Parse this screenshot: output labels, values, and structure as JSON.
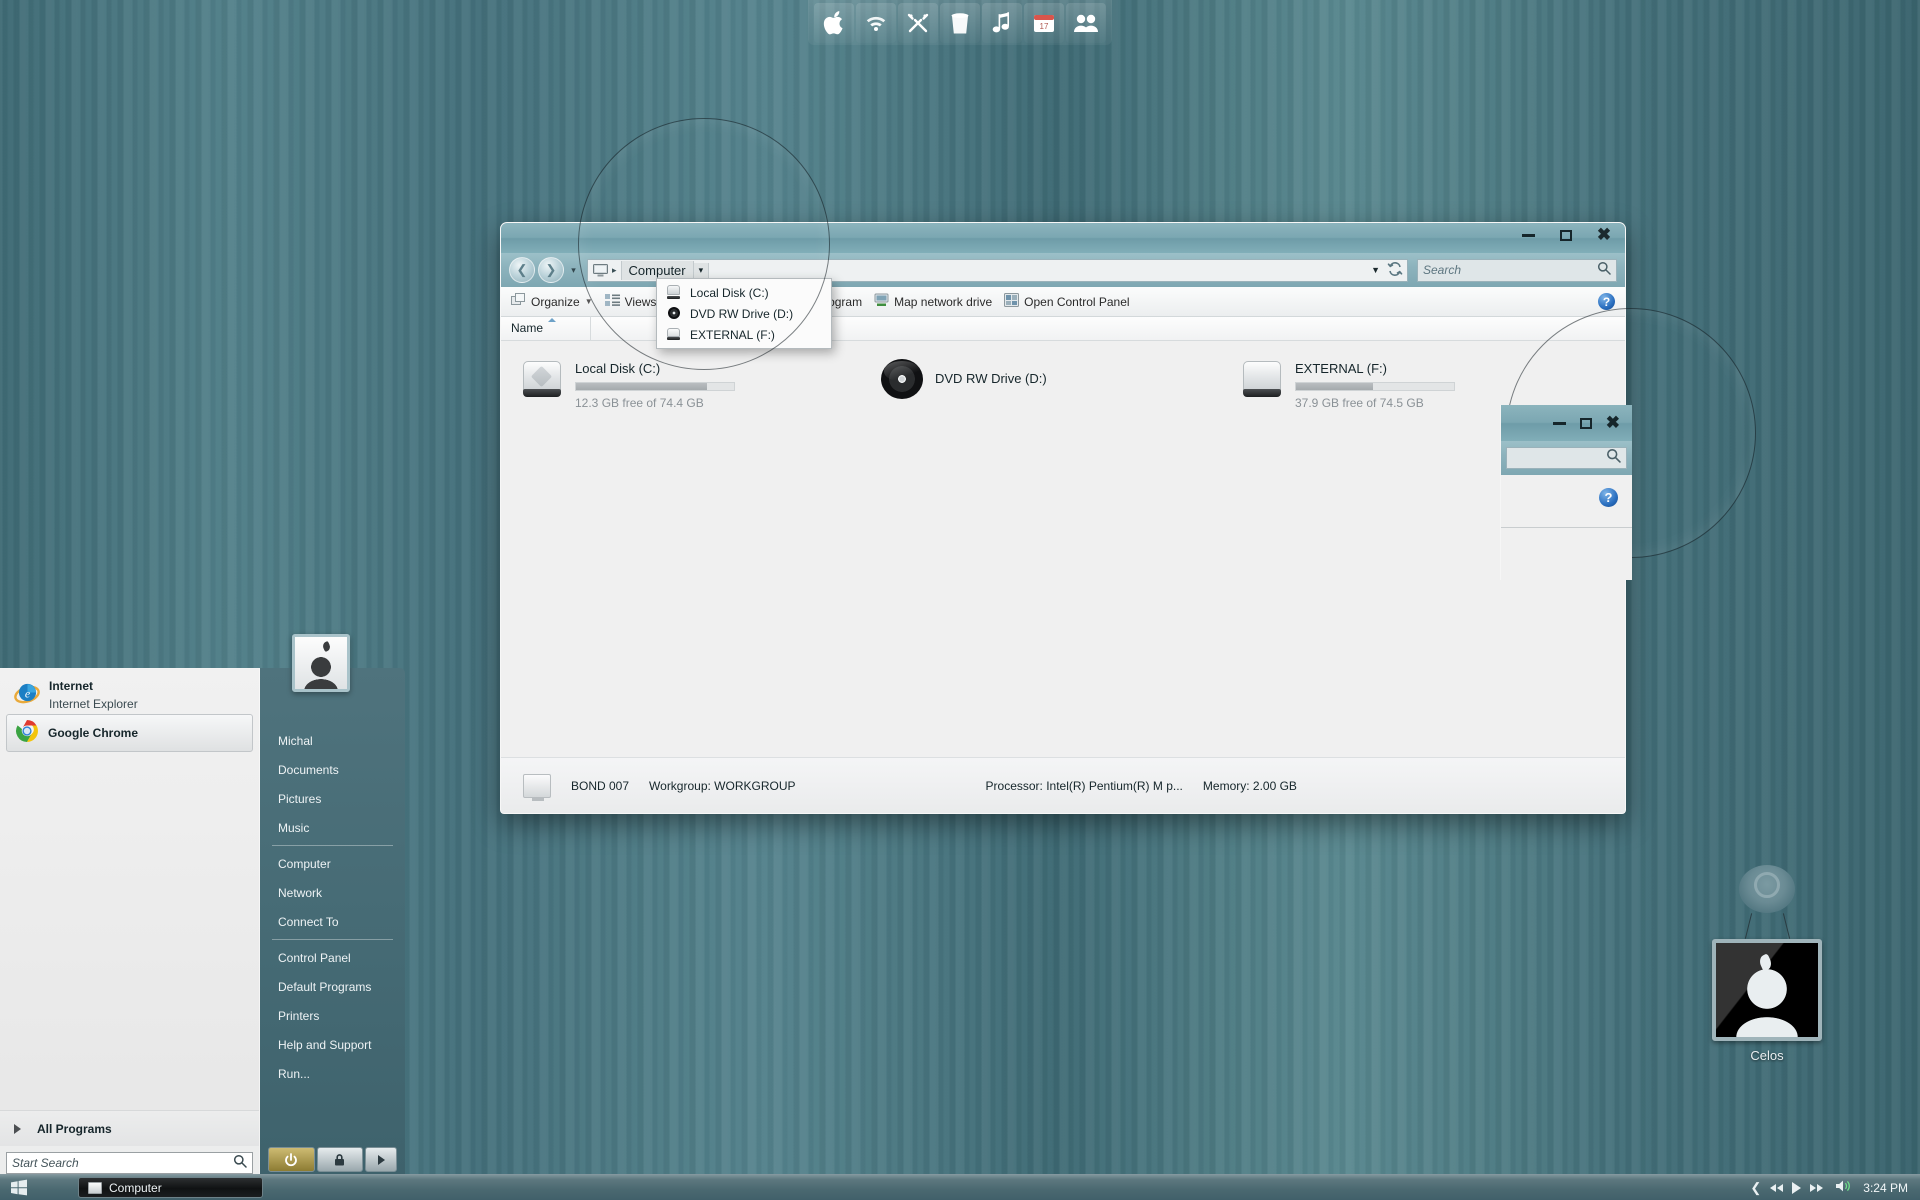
{
  "desktop": {
    "background_top": "#3f6b75",
    "background_bottom": "#5b8590"
  },
  "dock": {
    "items": [
      {
        "name": "apple-icon",
        "label": "Apple"
      },
      {
        "name": "wifi-icon",
        "label": "WiFi"
      },
      {
        "name": "tools-icon",
        "label": "Tools"
      },
      {
        "name": "trash-icon",
        "label": "Trash"
      },
      {
        "name": "music-icon",
        "label": "Music"
      },
      {
        "name": "calendar-icon",
        "label": "Calendar",
        "day": "17"
      },
      {
        "name": "users-icon",
        "label": "Users"
      }
    ]
  },
  "widget": {
    "label": "Celos"
  },
  "explorer": {
    "title": "",
    "window_controls": {
      "minimize": "–",
      "maximize": "□",
      "close": "X"
    },
    "address": {
      "computer_label": "Computer",
      "caret": "▾",
      "separator": "▸"
    },
    "search": {
      "placeholder": "Search"
    },
    "toolbar": {
      "organize": "Organize",
      "views": "Views",
      "uninstall": "Uninstall or change a program",
      "map_drive": "Map network drive",
      "control_panel": "Open Control Panel",
      "help": "?"
    },
    "columns": [
      "Name"
    ],
    "drives": [
      {
        "name": "Local Disk (C:)",
        "free_text": "12.3 GB free of 74.4 GB",
        "used_percent": 83,
        "icon": "hard-disk-icon"
      },
      {
        "name": "DVD RW Drive (D:)",
        "free_text": "",
        "used_percent": 0,
        "icon": "dvd-drive-icon"
      },
      {
        "name": "EXTERNAL (F:)",
        "free_text": "37.9 GB free of 74.5 GB",
        "used_percent": 49,
        "icon": "external-disk-icon"
      }
    ],
    "status": {
      "computer_name": "BOND 007",
      "workgroup": "Workgroup:  WORKGROUP",
      "processor": "Processor:  Intel(R) Pentium(R) M p...",
      "memory": "Memory:  2.00 GB"
    }
  },
  "path_dropdown": {
    "items": [
      {
        "label": "Local Disk (C:)",
        "icon": "hard-disk-icon"
      },
      {
        "label": "DVD RW Drive (D:)",
        "icon": "dvd-drive-icon"
      },
      {
        "label": "EXTERNAL (F:)",
        "icon": "external-disk-icon"
      }
    ]
  },
  "magnifier_inset": {
    "help": "?"
  },
  "start_menu": {
    "pinned": [
      {
        "title": "Internet",
        "subtitle": "Internet Explorer",
        "icon": "internet-explorer-icon",
        "selected": false
      },
      {
        "title": "Google Chrome",
        "subtitle": "",
        "icon": "google-chrome-icon",
        "selected": true
      }
    ],
    "all_programs": "All Programs",
    "search_placeholder": "Start Search",
    "right_items": [
      {
        "label": "Michal",
        "divider_after": false
      },
      {
        "label": "Documents",
        "divider_after": false
      },
      {
        "label": "Pictures",
        "divider_after": false
      },
      {
        "label": "Music",
        "divider_after": true
      },
      {
        "label": "Computer",
        "divider_after": false
      },
      {
        "label": "Network",
        "divider_after": false
      },
      {
        "label": "Connect To",
        "divider_after": true
      },
      {
        "label": "Control Panel",
        "divider_after": false
      },
      {
        "label": "Default Programs",
        "divider_after": false
      },
      {
        "label": "Printers",
        "divider_after": false
      },
      {
        "label": "Help and Support",
        "divider_after": false
      },
      {
        "label": "Run...",
        "divider_after": false
      }
    ],
    "power_buttons": [
      {
        "name": "shutdown-button",
        "icon": "power-icon"
      },
      {
        "name": "lock-button",
        "icon": "lock-icon"
      },
      {
        "name": "more-options-button",
        "icon": "chevron-right-icon"
      }
    ]
  },
  "taskbar": {
    "start_label": "Start",
    "tasks": [
      {
        "label": "Computer",
        "icon": "computer-icon",
        "active": true
      }
    ],
    "tray": {
      "prev": "❮",
      "rewind": "◂◂",
      "play": "▶",
      "forward": "▸▸",
      "volume": "volume-icon",
      "clock": "3:24 PM"
    }
  }
}
